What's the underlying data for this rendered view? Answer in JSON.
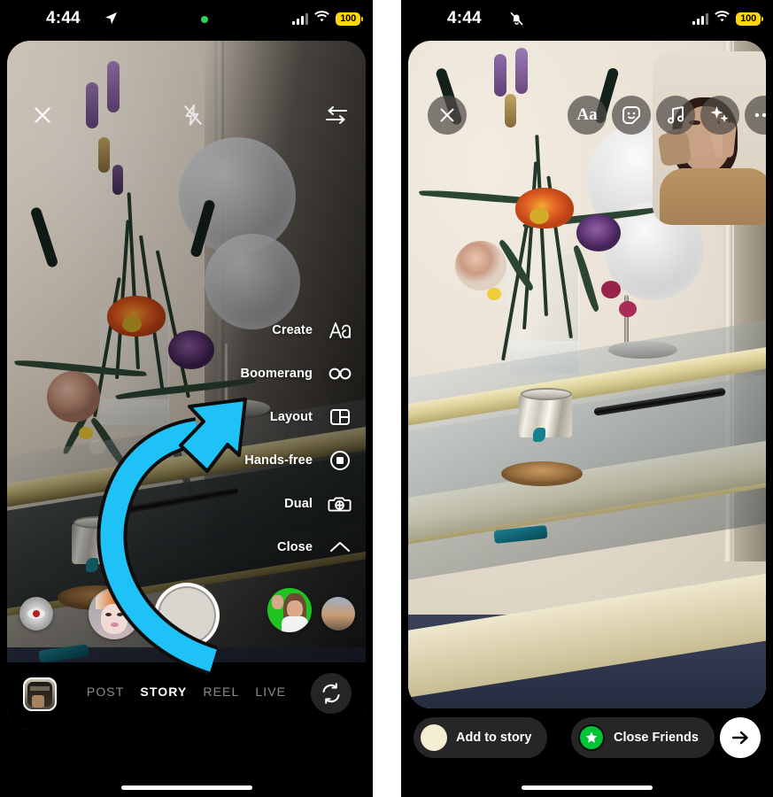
{
  "screens": [
    {
      "id": "camera-capture",
      "status_bar": {
        "time": "4:44",
        "location_icon": "location-arrow-icon",
        "recording_dot": "green-recording-dot",
        "cellular_icon": "cellular-bars-icon",
        "wifi_icon": "wifi-icon",
        "battery_level": "100",
        "battery_color": "#FFD60A"
      },
      "top_bar": {
        "close_icon": "close-x-icon",
        "flash_icon": "flash-off-icon",
        "swap_icon": "swap-arrows-icon"
      },
      "side_menu": [
        {
          "label": "Create",
          "icon": "text-aa-icon"
        },
        {
          "label": "Boomerang",
          "icon": "infinity-icon"
        },
        {
          "label": "Layout",
          "icon": "layout-grid-icon"
        },
        {
          "label": "Hands-free",
          "icon": "hands-free-record-icon"
        },
        {
          "label": "Dual",
          "icon": "dual-camera-icon"
        },
        {
          "label": "Close",
          "icon": "chevron-up-icon"
        }
      ],
      "annotation": {
        "type": "curved-arrow",
        "color": "#1FC2F7",
        "outline_color": "#0d0d0d",
        "points_to": "Dual"
      },
      "effects": [
        {
          "name": "eye-effect-thumbnail"
        },
        {
          "name": "avatar-face-filter-thumbnail"
        },
        {
          "name": "green-screen-effect-thumbnail"
        },
        {
          "name": "sunset-landscape-effect-thumbnail"
        }
      ],
      "shutter": {
        "name": "shutter-button"
      },
      "mode_bar": {
        "gallery_thumbnail": "gallery-thumbnail",
        "modes": [
          {
            "label": "POST",
            "active": false
          },
          {
            "label": "STORY",
            "active": true
          },
          {
            "label": "REEL",
            "active": false
          },
          {
            "label": "LIVE",
            "active": false
          }
        ],
        "flip_icon": "camera-flip-icon"
      }
    },
    {
      "id": "story-preview",
      "status_bar": {
        "time": "4:44",
        "silent_icon": "bell-slash-icon",
        "cellular_icon": "cellular-bars-icon",
        "wifi_icon": "wifi-icon",
        "battery_level": "100",
        "battery_color": "#FFD60A"
      },
      "top_bar": {
        "close_icon": "close-x-icon",
        "tools": [
          {
            "icon": "text-aa-icon",
            "label": "Aa"
          },
          {
            "icon": "sticker-smiley-icon"
          },
          {
            "icon": "music-note-icon"
          },
          {
            "icon": "sparkles-effects-icon"
          },
          {
            "icon": "more-ellipsis-icon"
          }
        ]
      },
      "pip": {
        "name": "front-camera-pip",
        "subject": "selfie-peace-sign"
      },
      "action_bar": {
        "add_to_story": {
          "label": "Add to story",
          "avatar": "user-avatar",
          "avatar_color": "#f5edd2"
        },
        "close_friends": {
          "label": "Close Friends",
          "icon": "close-friends-star-icon",
          "color": "#00C437"
        },
        "next": {
          "icon": "arrow-right-icon"
        }
      }
    }
  ]
}
